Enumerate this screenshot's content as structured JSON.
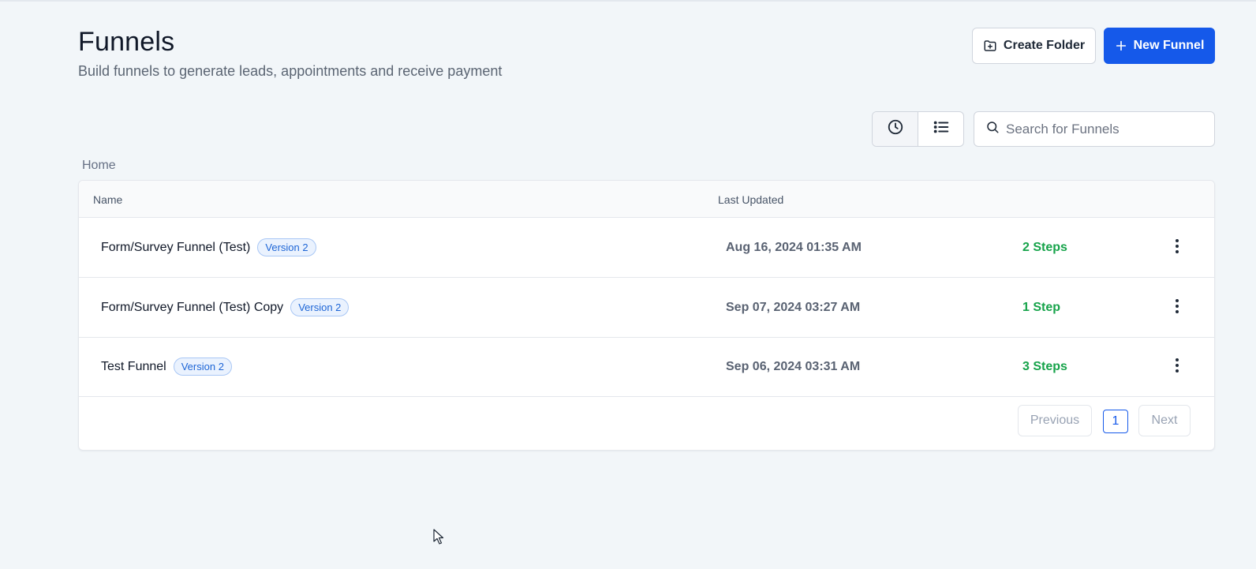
{
  "header": {
    "title": "Funnels",
    "subtitle": "Build funnels to generate leads, appointments and receive payment"
  },
  "actions": {
    "create_folder_label": "Create Folder",
    "new_funnel_label": "New Funnel"
  },
  "view_toggle": {
    "recent_icon": "clock-icon",
    "list_icon": "list-icon",
    "active": "recent"
  },
  "search": {
    "placeholder": "Search for Funnels",
    "value": ""
  },
  "breadcrumb": {
    "current": "Home"
  },
  "table": {
    "columns": [
      "Name",
      "Last Updated"
    ],
    "rows": [
      {
        "name": "Form/Survey Funnel (Test)",
        "badge": "Version 2",
        "updated": "Aug 16, 2024 01:35 AM",
        "steps": "2 Steps"
      },
      {
        "name": "Form/Survey Funnel (Test) Copy",
        "badge": "Version 2",
        "updated": "Sep 07, 2024 03:27 AM",
        "steps": "1 Step"
      },
      {
        "name": "Test Funnel",
        "badge": "Version 2",
        "updated": "Sep 06, 2024 03:31 AM",
        "steps": "3 Steps"
      }
    ]
  },
  "pagination": {
    "previous_label": "Previous",
    "current_page": "1",
    "next_label": "Next"
  },
  "colors": {
    "primary": "#1559ea",
    "steps_green": "#16a34a",
    "badge_blue": "#1d65d6",
    "background": "#f2f6f9"
  }
}
